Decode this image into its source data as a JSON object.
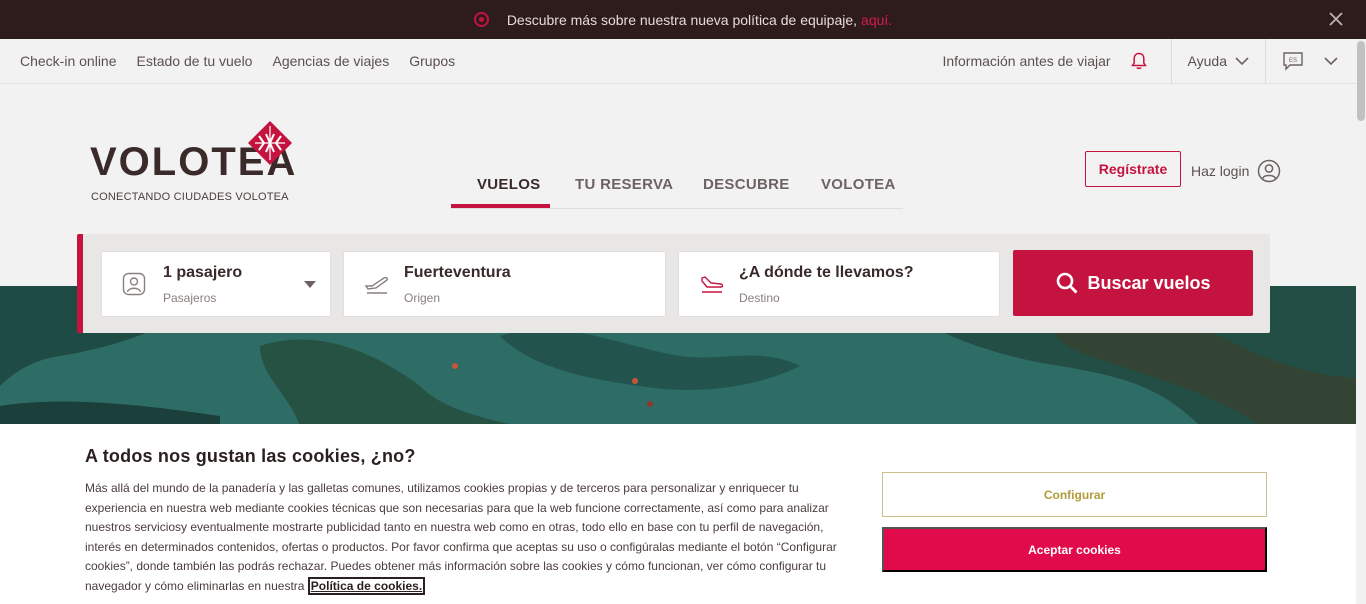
{
  "announcement": {
    "message": "Descubre más sobre nuestra nueva política de equipaje,",
    "link": "aquí."
  },
  "subnav": {
    "left_items": [
      "Check-in online",
      "Estado de tu vuelo",
      "Agencias de viajes",
      "Grupos"
    ],
    "info": "Información antes de viajar",
    "help": "Ayuda",
    "language": "ES"
  },
  "logo": {
    "wordmark": "VOLOTEA",
    "tagline": "CONECTANDO CIUDADES VOLOTEA"
  },
  "tabs": [
    {
      "label": "VUELOS",
      "active": true
    },
    {
      "label": "TU RESERVA",
      "active": false
    },
    {
      "label": "DESCUBRE",
      "active": false
    },
    {
      "label": "VOLOTEA",
      "active": false
    }
  ],
  "account": {
    "register": "Regístrate",
    "login": "Haz login"
  },
  "search": {
    "passengers": {
      "value": "1 pasajero",
      "label": "Pasajeros"
    },
    "origin": {
      "value": "Fuerteventura",
      "label": "Origen"
    },
    "destination": {
      "value": "¿A dónde te llevamos?",
      "label": "Destino"
    },
    "button": "Buscar vuelos"
  },
  "cookies": {
    "title": "A todos nos gustan las cookies, ¿no?",
    "body": "Más allá del mundo de la panadería y las galletas comunes, utilizamos cookies propias y de terceros para personalizar y enriquecer tu experiencia en nuestra web mediante cookies técnicas que son necesarias para que la web funcione correctamente, así como para analizar nuestros serviciosy eventualmente mostrarte publicidad tanto en nuestra web como en otras, todo ello en base con tu perfil de navegación, interés en determinados contenidos, ofertas o productos. Por favor confirma que aceptas su uso o configúralas mediante el botón “Configurar cookies”, donde también las podrás rechazar. Puedes obtener más información sobre las cookies y cómo funcionan, ver cómo configurar tu navegador y cómo eliminarlas en nuestra",
    "policy_link": "Política de cookies.",
    "configure": "Configurar",
    "accept": "Aceptar cookies"
  },
  "colors": {
    "brand": "#c5133f",
    "dark": "#2e1b1c",
    "accept": "#e10a4a"
  }
}
